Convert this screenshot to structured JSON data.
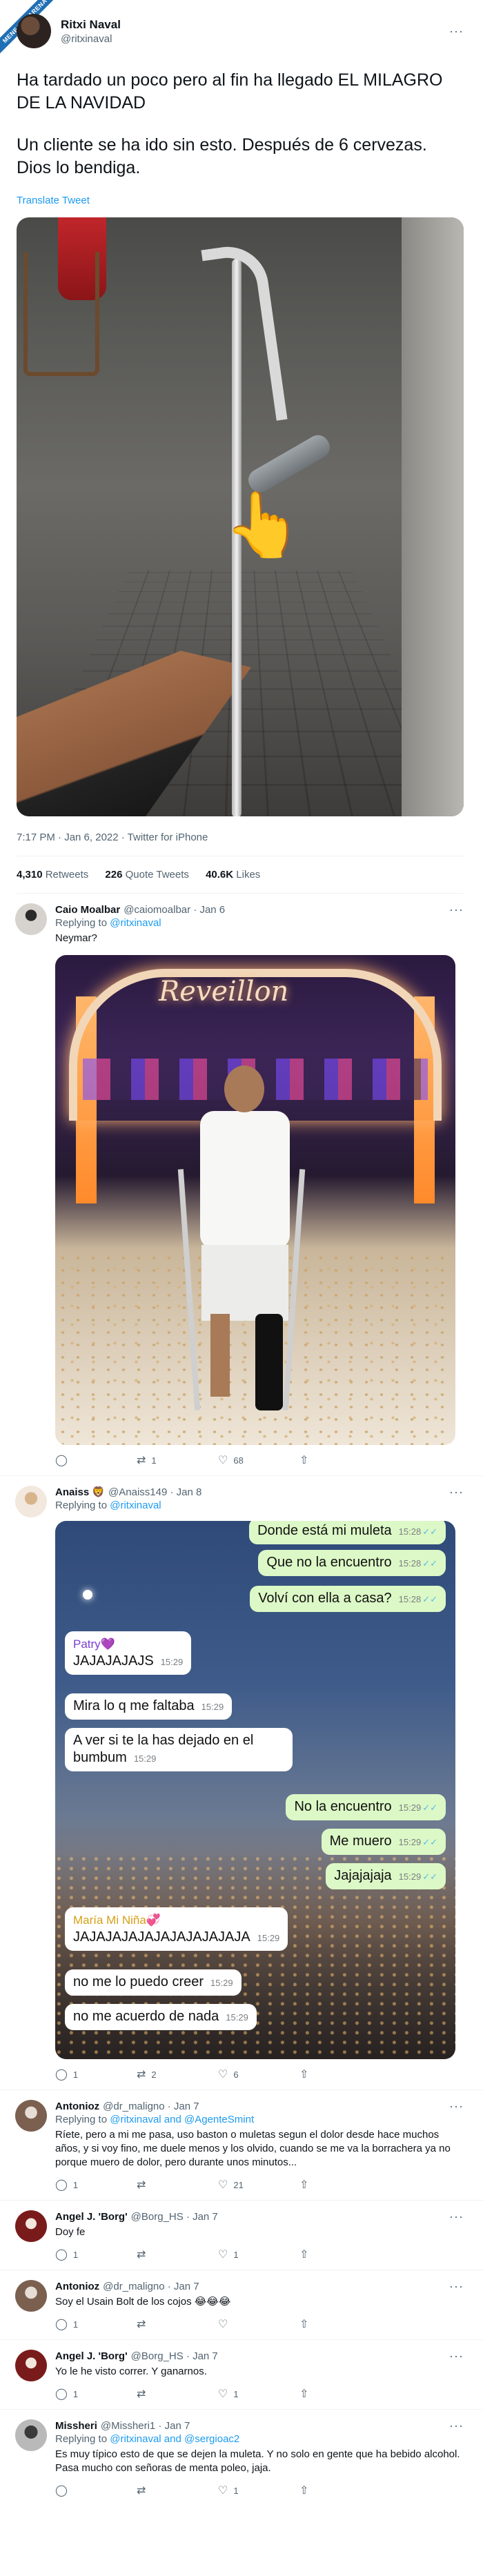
{
  "ribbon": "MENEAME ARENA",
  "main": {
    "name": "Ritxi Naval",
    "handle": "@ritxinaval",
    "paragraphs": [
      "Ha tardado un poco pero al fin ha llegado EL MILAGRO DE LA NAVIDAD",
      "Un cliente se ha ido sin esto. Después de 6 cervezas. Dios lo bendiga."
    ],
    "translate": "Translate Tweet",
    "photo_emoji": "👆",
    "meta": "7:17 PM · Jan 6, 2022 · Twitter for iPhone",
    "retweets": "4,310",
    "retweets_label": "Retweets",
    "quotes": "226",
    "quotes_label": "Quote Tweets",
    "likes": "40.6K",
    "likes_label": "Likes"
  },
  "replies": [
    {
      "name": "Caio Moalbar",
      "handle": "@caiomoalbar · Jan 6",
      "replying_prefix": "Replying to",
      "replying_to": "@ritxinaval",
      "text": "Neymar?",
      "media_text": "Reveillon",
      "counts": {
        "reply": "",
        "retweet": "1",
        "like": "68"
      }
    },
    {
      "name": "Anaiss 🦁",
      "handle": "@Anaiss149 · Jan 8",
      "replying_prefix": "Replying to",
      "replying_to": "@ritxinaval",
      "counts": {
        "reply": "1",
        "retweet": "2",
        "like": "6"
      }
    },
    {
      "name": "Antonioz",
      "handle": "@dr_maligno · Jan 7",
      "replying_prefix": "Replying to",
      "replying_to": "@ritxinaval and @AgenteSmint",
      "text": "Ríete, pero a mi me pasa, uso baston o muletas segun el dolor desde hace muchos años, y si voy fino, me duele menos y los olvido, cuando se me va la borrachera ya no porque muero de dolor, pero durante unos minutos...",
      "counts": {
        "reply": "1",
        "retweet": "",
        "like": "21"
      }
    },
    {
      "name": "Angel J. 'Borg'",
      "handle": "@Borg_HS · Jan 7",
      "text": "Doy fe",
      "counts": {
        "reply": "1",
        "retweet": "",
        "like": "1"
      }
    },
    {
      "name": "Antonioz",
      "handle": "@dr_maligno · Jan 7",
      "text": "Soy el Usain Bolt de los cojos 😂😂😂",
      "counts": {
        "reply": "1",
        "retweet": "",
        "like": ""
      }
    },
    {
      "name": "Angel J. 'Borg'",
      "handle": "@Borg_HS · Jan 7",
      "text": "Yo le he visto correr. Y ganarnos.",
      "counts": {
        "reply": "1",
        "retweet": "",
        "like": "1"
      }
    },
    {
      "name": "Missheri",
      "handle": "@Missheri1 · Jan 7",
      "replying_prefix": "Replying to",
      "replying_to": "@ritxinaval and @sergioac2",
      "text": "Es muy típico esto de que se dejen la muleta. Y no solo en gente que ha bebido alcohol. Pasa mucho con señoras de menta poleo, jaja.",
      "counts": {
        "reply": "",
        "retweet": "",
        "like": "1"
      }
    }
  ],
  "chat": [
    {
      "dir": "out",
      "text": "Donde está mi muleta",
      "time": "15:28"
    },
    {
      "dir": "out",
      "text": "Que no la encuentro",
      "time": "15:28"
    },
    {
      "dir": "out",
      "text": "Volví con ella a casa?",
      "time": "15:28"
    },
    {
      "dir": "in",
      "sender": "Patry💜",
      "text": "JAJAJAJAJS",
      "time": "15:29"
    },
    {
      "dir": "in",
      "text": "Mira lo q me faltaba",
      "time": "15:29"
    },
    {
      "dir": "in",
      "text": "A ver si te la has dejado en el bumbum",
      "time": "15:29"
    },
    {
      "dir": "out",
      "text": "No la encuentro",
      "time": "15:29"
    },
    {
      "dir": "out",
      "text": "Me muero",
      "time": "15:29"
    },
    {
      "dir": "out",
      "text": "Jajajajaja",
      "time": "15:29"
    },
    {
      "dir": "in",
      "sender": "María Mi Niña💞",
      "text": "JAJAJAJAJAJAJAJAJAJAJA",
      "time": "15:29"
    },
    {
      "dir": "in",
      "text": "no me lo puedo creer",
      "time": "15:29"
    },
    {
      "dir": "in",
      "text": "no me acuerdo de nada",
      "time": "15:29"
    }
  ],
  "icons": {
    "more": "···",
    "reply": "◯",
    "retweet": "⇄",
    "like": "♡",
    "share": "⇧",
    "tick": "✓✓"
  },
  "colors": {
    "link": "#1d9bf0",
    "muted": "#536471",
    "bubble_out": "#dcf8c6",
    "bubble_in": "#ffffff"
  }
}
